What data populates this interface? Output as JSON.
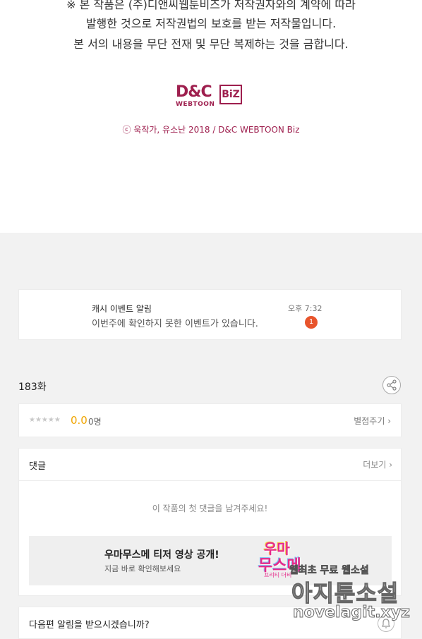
{
  "notice": {
    "line1": "※ 본 작품은 (주)디앤씨웹툰비즈가 저작권자와의 계약에 따라",
    "line2": "발행한 것으로 저작권법의 보호를 받는 저작물입니다.",
    "line3": "본 서의 내용을 무단 전재 및 무단 복제하는 것을 금합니다."
  },
  "publisher_logo": {
    "main": "D&C",
    "sub": "WEBTOON",
    "badge": "BiZ"
  },
  "copyright": "ⓒ 욱작가, 유소난 2018 / D&C WEBTOON Biz",
  "event": {
    "title": "캐시 이벤트 알림",
    "desc": "이번주에 확인하지 못한 이벤트가 있습니다.",
    "time": "오후 7:32",
    "badge": "1"
  },
  "episode": {
    "title": "183화"
  },
  "rating": {
    "stars": "★★★★★",
    "score": "0.0",
    "count": "0명",
    "rate_link": "별점주기 ›"
  },
  "comments": {
    "label": "댓글",
    "more": "더보기 ›",
    "empty": "이 작품의 첫 댓글을 남겨주세요!"
  },
  "banner": {
    "title": "우마무스메 티저 영상 공개!",
    "sub": "지금 바로 확인해보세요",
    "art_line1": "우마",
    "art_line2": "무스메",
    "art_line3": "프리티 더비"
  },
  "next_alert": {
    "label": "다음편 알림을 받으시겠습니까?"
  },
  "watermark": {
    "line1": "웹최초 무료 웹소설",
    "line2": "아지툰소설",
    "line3": "novelagit.xyz"
  },
  "colors": {
    "brand": "#9e1f4e",
    "accent_score": "#f0a500",
    "badge": "#e8542c"
  }
}
